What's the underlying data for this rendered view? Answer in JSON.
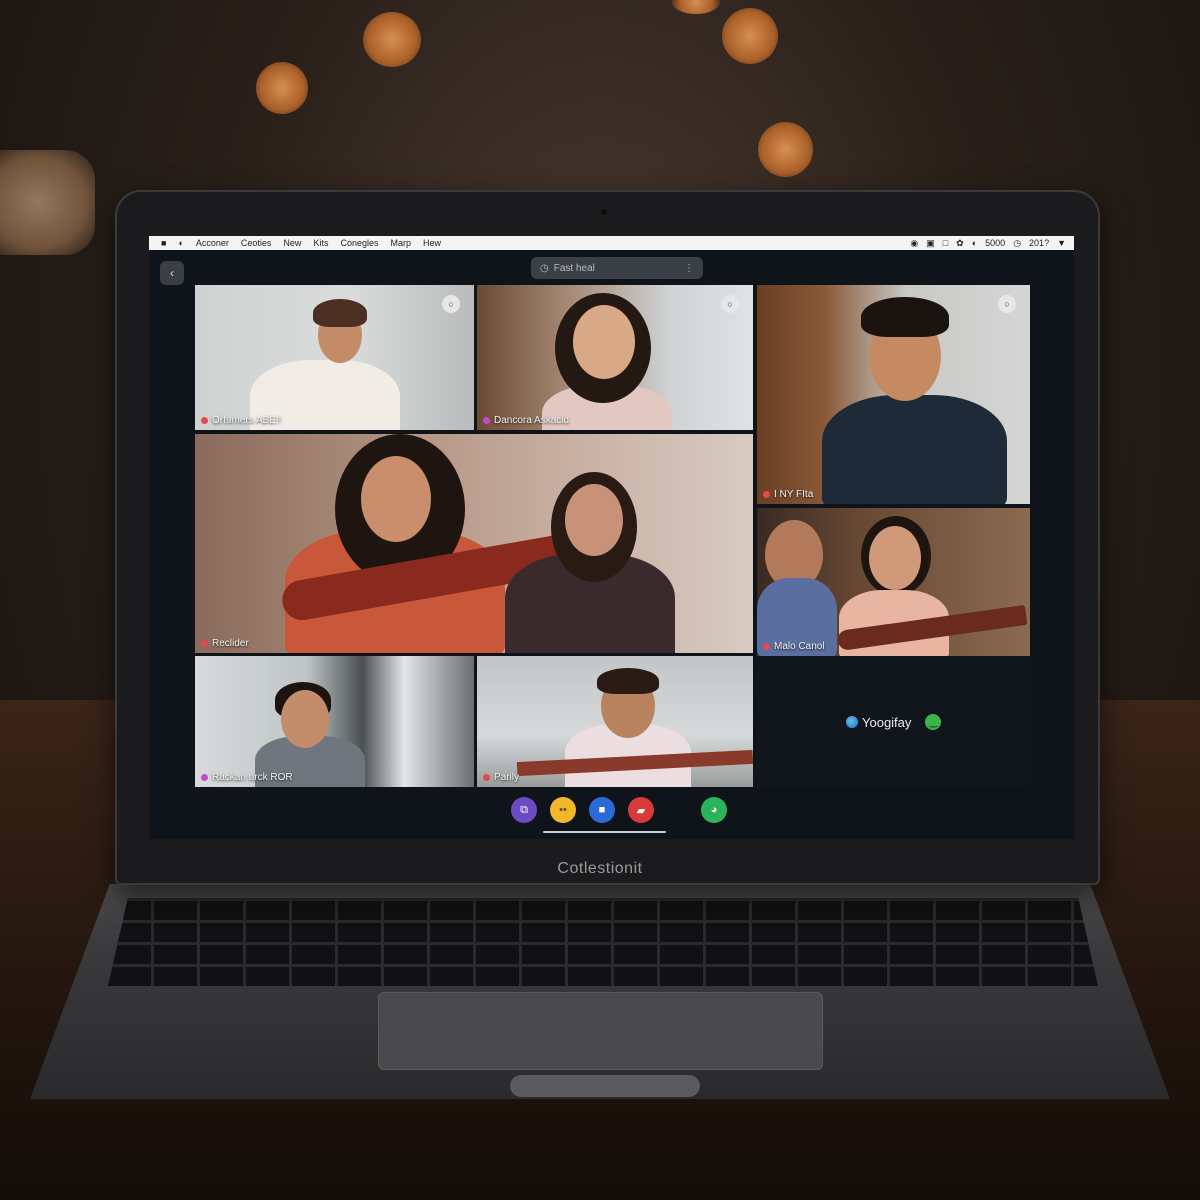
{
  "menubar": {
    "apple_icon": "apple-icon",
    "items": [
      "Acconer",
      "Ceoties",
      "New",
      "Kits",
      "Conegles",
      "Marp",
      "Hew"
    ],
    "status_text": "5000",
    "clock": "201?"
  },
  "toolbar": {
    "back_glyph": "‹",
    "search_placeholder": "Fast heal",
    "more_glyph": "⋮"
  },
  "tiles": [
    {
      "name": "Orfumers ABE!!",
      "dot_color": "#e6474b"
    },
    {
      "name": "Dancora Askacld",
      "dot_color": "#c04ad0"
    },
    {
      "name": "I NY FIta",
      "dot_color": "#e6474b"
    },
    {
      "name": "Reclider",
      "dot_color": "#e6474b"
    },
    {
      "name": "Malo Canol",
      "dot_color": "#e6474b"
    },
    {
      "name": "Rackan urck ROR",
      "dot_color": "#c04ad0"
    },
    {
      "name": "Parily",
      "dot_color": "#e6474b"
    }
  ],
  "empty_slot": {
    "label": "Yoogifay"
  },
  "controls": [
    {
      "icon": "share-screen-icon",
      "color": "#6a4bc4"
    },
    {
      "icon": "emoji-icon",
      "color": "#f2b72a"
    },
    {
      "icon": "chat-icon",
      "color": "#2a6ad8"
    },
    {
      "icon": "end-call-icon",
      "color": "#d83a3a"
    },
    {
      "icon": "participants-icon",
      "color": "#2ab35a"
    }
  ],
  "laptop": {
    "brand": "Cotlestionit"
  }
}
